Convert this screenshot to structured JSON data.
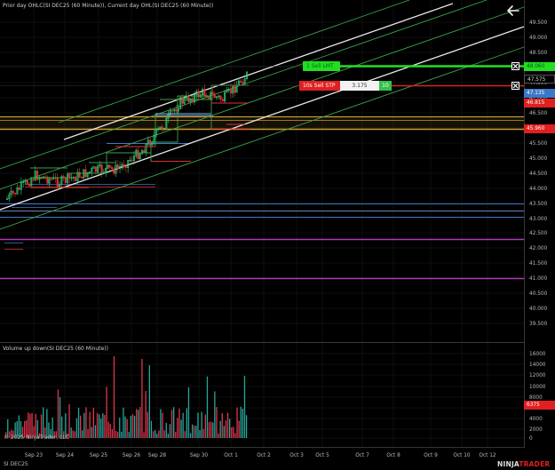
{
  "top_title": "Prior day OHLC(SI DEC25 (60 Minute)), Current day OHL(SI DEC25 (60 Minute))",
  "volume_title": "Volume up down(SI DEC25 (60 Minute))",
  "copyright": "© 2025 NinjaTrader, LLC",
  "instrument_footer": "SI DEC25",
  "brand": {
    "main": "NINJA",
    "accent": "TRADER"
  },
  "price_axis": [
    "49.500",
    "49.000",
    "48.500",
    "48.000",
    "47.500",
    "47.000",
    "46.500",
    "46.000",
    "45.500",
    "45.000",
    "44.500",
    "44.000",
    "43.500",
    "43.000",
    "42.500",
    "42.000",
    "41.500",
    "41.000",
    "40.500",
    "40.000",
    "39.500"
  ],
  "volume_axis": [
    "16000",
    "14000",
    "12000",
    "10000",
    "8000",
    "6000",
    "4000",
    "2000",
    "0"
  ],
  "date_axis": [
    "Sep 23",
    "Sep 24",
    "Sep 25",
    "Sep 26",
    "Sep 28",
    "Sep 30",
    "Oct 1",
    "Oct 2",
    "Oct 3",
    "Oct 5",
    "Oct 7",
    "Oct 8",
    "Oct 9",
    "Oct 10",
    "Oct 12"
  ],
  "orders": {
    "sell_limit": {
      "label": "1 Sell LMT",
      "price": "48.060",
      "color": "#22dd22"
    },
    "sell_stop": {
      "label": "10s Sell STP",
      "value": "3.175",
      "qty": "10",
      "color": "#e02020"
    }
  },
  "price_markers": [
    {
      "label": "47.575",
      "bg": "#000000",
      "fg": "#dddddd"
    },
    {
      "label": "47.135",
      "bg": "#3b78c9",
      "fg": "#ffffff"
    },
    {
      "label": "46.815",
      "bg": "#e02020",
      "fg": "#ffffff"
    },
    {
      "label": "45.960",
      "bg": "#e02020",
      "fg": "#ffffff"
    }
  ],
  "volume_marker": {
    "label": "6375",
    "bg": "#e02020",
    "fg": "#ffffff"
  },
  "colors": {
    "background": "#000000",
    "grid": "#1d1d1d",
    "channel_white": "#e8e8e8",
    "channel_green": "#3aa04a",
    "candle_up": "#2ed37a",
    "candle_down": "#e03030",
    "band_gold": "#c99a2e",
    "magenta": "#b03ab8",
    "blue_line": "#3b78c9",
    "vol_up": "#26a69a",
    "vol_down": "#e0354d"
  },
  "icons": {
    "back": "arrow-left-icon",
    "close": "close-icon"
  }
}
